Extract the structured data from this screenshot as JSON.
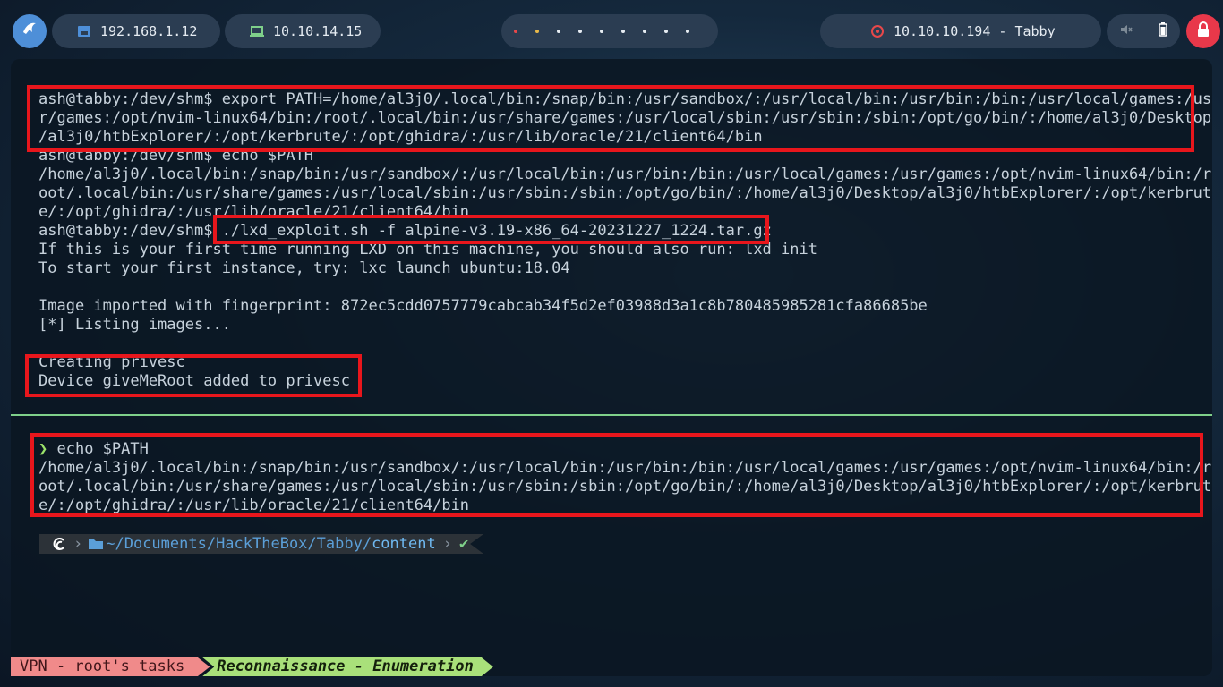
{
  "topbar": {
    "launcher_icon": "shark-icon",
    "lan_ip": "192.168.1.12",
    "vpn_ip": "10.10.14.15",
    "workspaces": [
      "red",
      "yellow",
      "",
      "",
      "",
      "",
      "",
      "",
      ""
    ],
    "target": "10.10.10.194 - Tabby",
    "tray_icons": [
      "mute-icon",
      "battery-icon"
    ],
    "lock_icon": "lock-icon"
  },
  "terminal": {
    "top_pane": [
      "ash@tabby:/dev/shm$ export PATH=/home/al3j0/.local/bin:/snap/bin:/usr/sandbox/:/usr/local/bin:/usr/bin:/bin:/usr/local/games:/us",
      "r/games:/opt/nvim-linux64/bin:/root/.local/bin:/usr/share/games:/usr/local/sbin:/usr/sbin:/sbin:/opt/go/bin/:/home/al3j0/Desktop",
      "/al3j0/htbExplorer/:/opt/kerbrute/:/opt/ghidra/:/usr/lib/oracle/21/client64/bin",
      "ash@tabby:/dev/shm$ echo $PATH",
      "/home/al3j0/.local/bin:/snap/bin:/usr/sandbox/:/usr/local/bin:/usr/bin:/bin:/usr/local/games:/usr/games:/opt/nvim-linux64/bin:/r",
      "oot/.local/bin:/usr/share/games:/usr/local/sbin:/usr/sbin:/sbin:/opt/go/bin/:/home/al3j0/Desktop/al3j0/htbExplorer/:/opt/kerbrut",
      "e/:/opt/ghidra/:/usr/lib/oracle/21/client64/bin",
      "ash@tabby:/dev/shm$ ./lxd_exploit.sh -f alpine-v3.19-x86_64-20231227_1224.tar.gz",
      "If this is your first time running LXD on this machine, you should also run: lxd init",
      "To start your first instance, try: lxc launch ubuntu:18.04",
      "",
      "Image imported with fingerprint: 872ec5cdd0757779cabcab34f5d2ef03988d3a1c8b780485985281cfa86685be",
      "[*] Listing images...",
      "",
      "Creating privesc",
      "Device giveMeRoot added to privesc"
    ],
    "bottom_pane": {
      "prompt_symbol": "❯",
      "command": "echo $PATH",
      "output": [
        "/home/al3j0/.local/bin:/snap/bin:/usr/sandbox/:/usr/local/bin:/usr/bin:/bin:/usr/local/games:/usr/games:/opt/nvim-linux64/bin:/r",
        "oot/.local/bin:/usr/share/games:/usr/local/sbin:/usr/sbin:/sbin:/opt/go/bin/:/home/al3j0/Desktop/al3j0/htbExplorer/:/opt/kerbrut",
        "e/:/opt/ghidra/:/usr/lib/oracle/21/client64/bin"
      ],
      "powerline": {
        "os_icon": "debian-swirl-icon",
        "path_prefix": "~/Documents/HackTheBox/Tabby/",
        "path_current": "content",
        "status": "✔"
      }
    }
  },
  "statusbar": {
    "left": "VPN - root's tasks",
    "right": "Reconnaissance - Enumeration"
  },
  "colors": {
    "highlight": "#e8161c",
    "divider": "#7fd08a",
    "accent": "#9be36a"
  }
}
